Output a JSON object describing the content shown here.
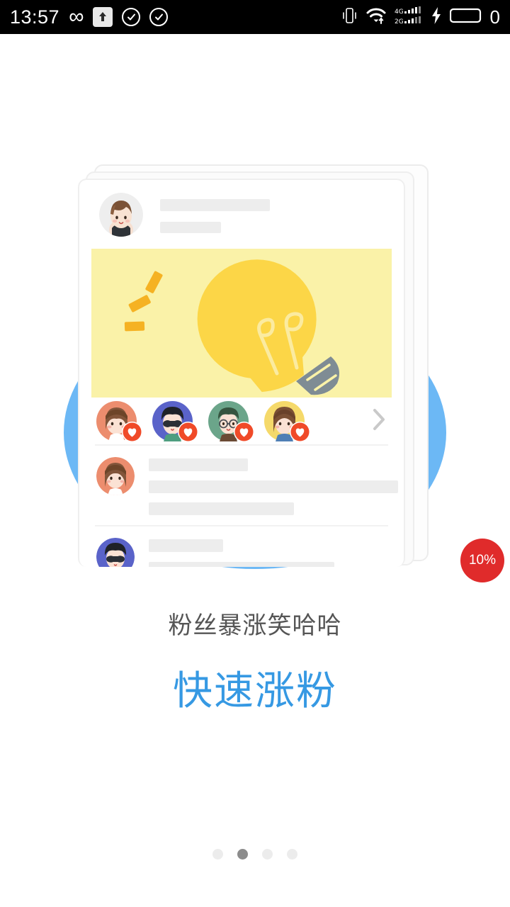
{
  "status_bar": {
    "time": "13:57",
    "left_icons": [
      {
        "name": "infinity-icon",
        "glyph": "∞"
      },
      {
        "name": "upload-icon",
        "glyph": "↑"
      },
      {
        "name": "check-circle-icon-1",
        "glyph": "✓"
      },
      {
        "name": "check-circle-icon-2",
        "glyph": "✓"
      }
    ],
    "right_icons": [
      {
        "name": "vibrate-icon"
      },
      {
        "name": "wifi-icon"
      },
      {
        "name": "signal-4g-icon",
        "label_top": "4G",
        "label_bottom": "2G"
      },
      {
        "name": "charging-bolt-icon",
        "glyph": "⚡"
      },
      {
        "name": "battery-icon"
      }
    ],
    "battery_level": "0"
  },
  "card": {
    "header": {
      "avatar": "avatar-boy-brown-hair",
      "placeholder_name": "",
      "placeholder_meta": ""
    },
    "hero_image": {
      "name": "lightbulb-illustration",
      "background_color": "#faf2a8",
      "bulb_color": "#fcd647",
      "ray_color": "#f5b223",
      "base_color": "#7f8c94"
    },
    "likers": [
      {
        "name": "liker-avatar-1",
        "badge": "heart-icon"
      },
      {
        "name": "liker-avatar-2",
        "badge": "heart-icon"
      },
      {
        "name": "liker-avatar-3",
        "badge": "heart-icon"
      },
      {
        "name": "liker-avatar-4",
        "badge": "heart-icon"
      }
    ],
    "likers_more": "chevron-right-icon",
    "comments": [
      {
        "avatar": "avatar-girl-bob",
        "lines": [
          140,
          410,
          245
        ]
      },
      {
        "avatar": "avatar-man-sunglasses",
        "lines": [
          105,
          270
        ]
      }
    ]
  },
  "progress_badge": {
    "label": "10%",
    "color": "#e02b2b"
  },
  "caption": {
    "subtitle": "粉丝暴涨笑哈哈",
    "title": "快速涨粉",
    "subtitle_color": "#555555",
    "title_color": "#3699e3"
  },
  "pager": {
    "total": 4,
    "active_index": 1,
    "active_color": "#8c8c8c",
    "inactive_color": "#ececec"
  },
  "theme": {
    "background": "#ffffff",
    "blob_blue": "#6cb8f5",
    "placeholder_gray": "#ededed"
  }
}
